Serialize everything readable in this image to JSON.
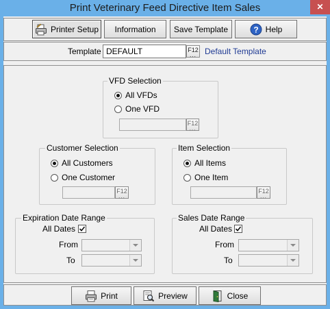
{
  "window": {
    "title": "Print Veterinary Feed Directive Item Sales",
    "close_glyph": "✕"
  },
  "toolbar": {
    "printer_setup": "Printer Setup",
    "information": "Information",
    "save_template": "Save Template",
    "help": "Help"
  },
  "template": {
    "label": "Template",
    "value": "DEFAULT",
    "f12": "F12",
    "description": "Default Template"
  },
  "vfd_selection": {
    "legend": "VFD Selection",
    "option_all": "All VFDs",
    "option_one": "One VFD",
    "selected": "all",
    "f12": "F12"
  },
  "customer_selection": {
    "legend": "Customer Selection",
    "option_all": "All Customers",
    "option_one": "One Customer",
    "selected": "all",
    "f12": "F12"
  },
  "item_selection": {
    "legend": "Item Selection",
    "option_all": "All Items",
    "option_one": "One Item",
    "selected": "all",
    "f12": "F12"
  },
  "expiration_date_range": {
    "legend": "Expiration Date Range",
    "all_dates_label": "All Dates",
    "all_dates_checked": true,
    "from_label": "From",
    "to_label": "To"
  },
  "sales_date_range": {
    "legend": "Sales Date Range",
    "all_dates_label": "All Dates",
    "all_dates_checked": true,
    "from_label": "From",
    "to_label": "To"
  },
  "footer": {
    "print": "Print",
    "preview": "Preview",
    "close": "Close"
  },
  "colors": {
    "title_bar": "#6ab0e8",
    "close_button": "#c75050",
    "link_text": "#1f3a93"
  },
  "icons": {
    "printer_setup": "printer-setup-icon",
    "help": "help-icon",
    "print": "print-icon",
    "preview": "preview-icon",
    "close": "close-door-icon"
  }
}
